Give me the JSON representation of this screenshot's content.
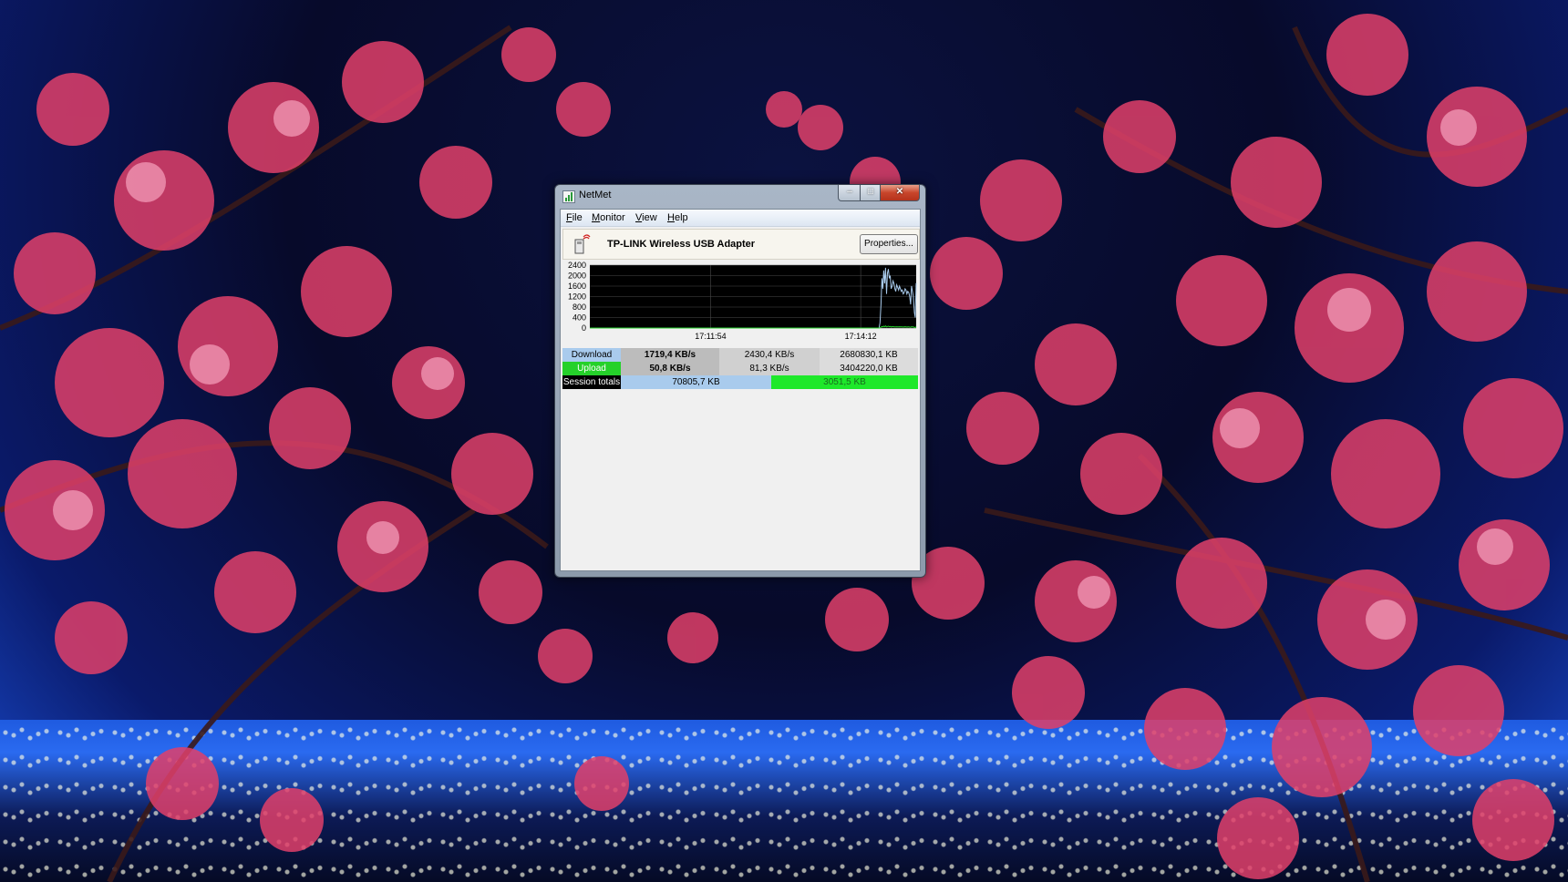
{
  "window": {
    "title": "NetMet",
    "controls": {
      "minimize": "–",
      "maximize": "□",
      "close": "✕"
    }
  },
  "menu": {
    "items": [
      "File",
      "Monitor",
      "View",
      "Help"
    ]
  },
  "adapter": {
    "name": "TP-LINK Wireless USB Adapter",
    "properties_label": "Properties..."
  },
  "graph": {
    "y_ticks": [
      "2400",
      "2000",
      "1600",
      "1200",
      "800",
      "400",
      "0"
    ],
    "x_ticks": [
      "17:11:54",
      "17:14:12"
    ],
    "colors": {
      "download": "#a9cbed",
      "upload": "#25d12a",
      "background": "#000000",
      "grid": "#4a4a4a"
    }
  },
  "chart_data": {
    "type": "line",
    "ylim": [
      0,
      2400
    ],
    "series": [
      {
        "name": "Download",
        "values": [
          0,
          0,
          0,
          0,
          0,
          0,
          0,
          0,
          0,
          0,
          0,
          0,
          0,
          0,
          0,
          0,
          0,
          0,
          0,
          0,
          0,
          0,
          0,
          0,
          0,
          0,
          0,
          0,
          0,
          0,
          0,
          0,
          0,
          0,
          0,
          0,
          0,
          0,
          0,
          0,
          0,
          0,
          0,
          0,
          0,
          0,
          0,
          0,
          0,
          0,
          0,
          0,
          0,
          0,
          0,
          0,
          0,
          0,
          0,
          0,
          0,
          0,
          0,
          0,
          0,
          0,
          0,
          0,
          0,
          0,
          0,
          0,
          0,
          0,
          0,
          0,
          0,
          0,
          0,
          0,
          0,
          0,
          0,
          0,
          0,
          0,
          0,
          0,
          0,
          0,
          0,
          0,
          0,
          0,
          0,
          0,
          0,
          0,
          0,
          0,
          0,
          0,
          0,
          0,
          0,
          0,
          0,
          0,
          0,
          0,
          0,
          0,
          0,
          0,
          0,
          0,
          0,
          0,
          0,
          0,
          0,
          0,
          0,
          0,
          0,
          0,
          0,
          0,
          0,
          0,
          0,
          0,
          0,
          0,
          0,
          0,
          0,
          0,
          0,
          0,
          0,
          0,
          0,
          0,
          0,
          0,
          0,
          0,
          0,
          0,
          0,
          0,
          0,
          0,
          0,
          0,
          0,
          0,
          0,
          0,
          0,
          0,
          0,
          0,
          0,
          0,
          0,
          0,
          0,
          0,
          0,
          0,
          0,
          0,
          0,
          0,
          0,
          0,
          0,
          0,
          0,
          0,
          0,
          0,
          0,
          0,
          0,
          0,
          0,
          0,
          0,
          0,
          0,
          0,
          0,
          0,
          0,
          0,
          0,
          0,
          0,
          0,
          0,
          0,
          0,
          0,
          0,
          0,
          0,
          0,
          0,
          0,
          0,
          0,
          0,
          0,
          0,
          0,
          0,
          0,
          0,
          0,
          0,
          0,
          0,
          0,
          0,
          0,
          0,
          0,
          0,
          0,
          0,
          0,
          0,
          0,
          0,
          0,
          0,
          0,
          0,
          0,
          0,
          0,
          0,
          0,
          0,
          0,
          0,
          0,
          0,
          0,
          0,
          0,
          0,
          0,
          0,
          0,
          0,
          0,
          0,
          0,
          0,
          0,
          0,
          0,
          0,
          0,
          0,
          0,
          0,
          0,
          0,
          0,
          0,
          0,
          0,
          0,
          0,
          0,
          0,
          0,
          0,
          0,
          0,
          0,
          0,
          0,
          0,
          0,
          0,
          0,
          0,
          0,
          0,
          0,
          0,
          0,
          0,
          0,
          0,
          0,
          0,
          0,
          0,
          0,
          0,
          0,
          0,
          0,
          0,
          0,
          0,
          200,
          900,
          1900,
          1500,
          2200,
          1700,
          2300,
          1300,
          2100,
          2250,
          1900,
          2000,
          1500,
          1600,
          1800,
          1700,
          1500,
          1400,
          1650,
          1550,
          1450,
          1600,
          1500,
          1400,
          1450,
          1300,
          1350,
          1500,
          1450,
          1300,
          1400,
          1350,
          1200,
          900,
          1600,
          1400,
          1200,
          600,
          400,
          1719
        ]
      },
      {
        "name": "Upload",
        "values": [
          0,
          0,
          0,
          0,
          0,
          0,
          0,
          0,
          0,
          0,
          0,
          0,
          0,
          0,
          0,
          0,
          0,
          0,
          0,
          0,
          0,
          0,
          0,
          0,
          0,
          0,
          0,
          0,
          0,
          0,
          0,
          0,
          0,
          0,
          0,
          0,
          0,
          0,
          0,
          0,
          0,
          0,
          0,
          0,
          0,
          0,
          0,
          0,
          0,
          0,
          0,
          0,
          0,
          0,
          0,
          0,
          0,
          0,
          0,
          0,
          0,
          0,
          0,
          0,
          0,
          0,
          0,
          0,
          0,
          0,
          0,
          0,
          0,
          0,
          0,
          0,
          0,
          0,
          0,
          0,
          0,
          0,
          0,
          0,
          0,
          0,
          0,
          0,
          0,
          0,
          0,
          0,
          0,
          0,
          0,
          0,
          0,
          0,
          0,
          0,
          0,
          0,
          0,
          0,
          0,
          0,
          0,
          0,
          0,
          0,
          0,
          0,
          0,
          0,
          0,
          0,
          0,
          0,
          0,
          0,
          0,
          0,
          0,
          0,
          0,
          0,
          0,
          0,
          0,
          0,
          0,
          0,
          0,
          0,
          0,
          0,
          0,
          0,
          0,
          0,
          0,
          0,
          0,
          0,
          0,
          0,
          0,
          0,
          0,
          0,
          0,
          0,
          0,
          0,
          0,
          0,
          0,
          0,
          0,
          0,
          0,
          0,
          0,
          0,
          0,
          0,
          0,
          0,
          0,
          0,
          0,
          0,
          0,
          0,
          0,
          0,
          0,
          0,
          0,
          0,
          0,
          0,
          0,
          0,
          0,
          0,
          0,
          0,
          0,
          0,
          0,
          0,
          0,
          0,
          0,
          0,
          0,
          0,
          0,
          0,
          0,
          0,
          0,
          0,
          0,
          0,
          0,
          0,
          0,
          0,
          0,
          0,
          0,
          0,
          0,
          0,
          0,
          0,
          0,
          0,
          0,
          0,
          0,
          0,
          0,
          0,
          0,
          0,
          0,
          0,
          0,
          0,
          0,
          0,
          0,
          0,
          0,
          0,
          0,
          0,
          0,
          0,
          0,
          0,
          0,
          0,
          0,
          0,
          0,
          0,
          0,
          0,
          0,
          0,
          0,
          0,
          0,
          0,
          0,
          0,
          0,
          0,
          0,
          0,
          0,
          0,
          0,
          0,
          0,
          0,
          0,
          0,
          0,
          0,
          0,
          0,
          0,
          0,
          0,
          0,
          0,
          0,
          0,
          0,
          0,
          0,
          0,
          0,
          0,
          0,
          0,
          0,
          0,
          0,
          0,
          0,
          0,
          0,
          0,
          0,
          0,
          0,
          0,
          0,
          0,
          0,
          0,
          0,
          0,
          0,
          0,
          0,
          0,
          0,
          10,
          30,
          60,
          40,
          70,
          50,
          80,
          40,
          60,
          70,
          50,
          60,
          40,
          50,
          55,
          45,
          40,
          45,
          50,
          45,
          40,
          50,
          45,
          40,
          45,
          35,
          40,
          50,
          45,
          35,
          40,
          45,
          35,
          30,
          50,
          45,
          40,
          20,
          15,
          51
        ]
      }
    ]
  },
  "stats": {
    "download": {
      "label": "Download",
      "current": "1719,4 KB/s",
      "max": "2430,4 KB/s",
      "total": "2680830,1 KB"
    },
    "upload": {
      "label": "Upload",
      "current": "50,8 KB/s",
      "max": "81,3 KB/s",
      "total": "3404220,0 KB"
    },
    "session": {
      "label": "Session totals",
      "download": "70805,7 KB",
      "upload": "3051,5 KB"
    }
  }
}
